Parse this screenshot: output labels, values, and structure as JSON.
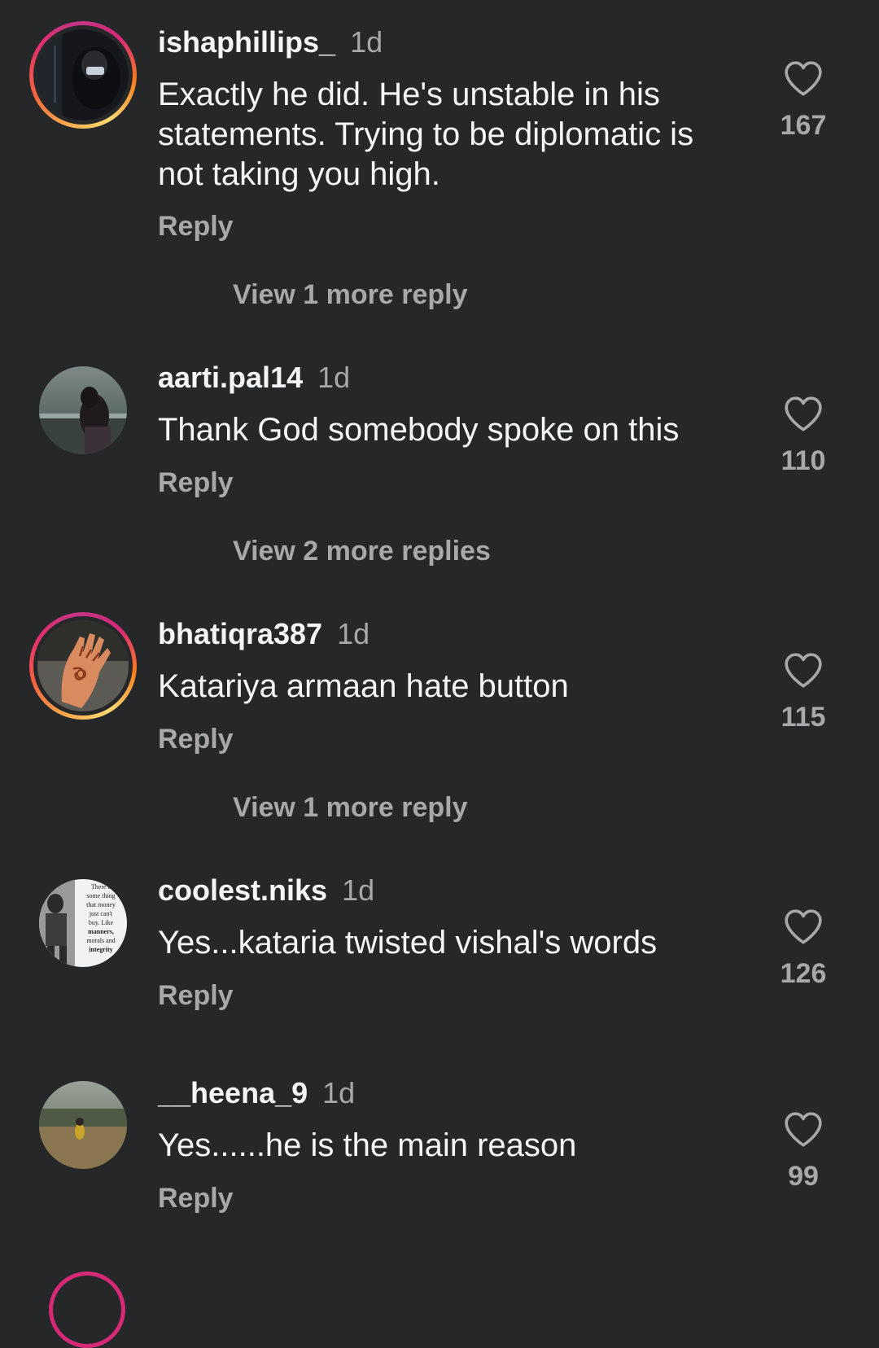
{
  "comments": [
    {
      "username": "ishaphillips_",
      "time": "1d",
      "text": "Exactly he did. He's unstable in his statements. Trying to be diplomatic is not taking you high.",
      "reply_label": "Reply",
      "likes": "167",
      "view_more": "View 1 more reply",
      "has_story": true
    },
    {
      "username": "aarti.pal14",
      "time": "1d",
      "text": "Thank God somebody spoke on this",
      "reply_label": "Reply",
      "likes": "110",
      "view_more": "View 2 more replies",
      "has_story": false
    },
    {
      "username": "bhatiqra387",
      "time": "1d",
      "text": "Katariya armaan hate button",
      "reply_label": "Reply",
      "likes": "115",
      "view_more": "View 1 more reply",
      "has_story": true
    },
    {
      "username": "coolest.niks",
      "time": "1d",
      "text": "Yes...kataria twisted vishal's words",
      "reply_label": "Reply",
      "likes": "126",
      "has_story": false
    },
    {
      "username": "__heena_9",
      "time": "1d",
      "text": "Yes......he is the main reason",
      "reply_label": "Reply",
      "likes": "99",
      "has_story": false
    }
  ],
  "avatar_texts": {
    "coolest_niks": [
      "There a",
      "some thing",
      "that money",
      "just can't",
      "buy. Like",
      "manners,",
      "morals and",
      "integrity"
    ]
  },
  "colors": {
    "background": "#262729",
    "primary_text": "#f5f5f5",
    "secondary_text": "#a8a8a8",
    "story_ring": "#d62976"
  },
  "icons": {
    "like": "heart-outline-icon"
  }
}
